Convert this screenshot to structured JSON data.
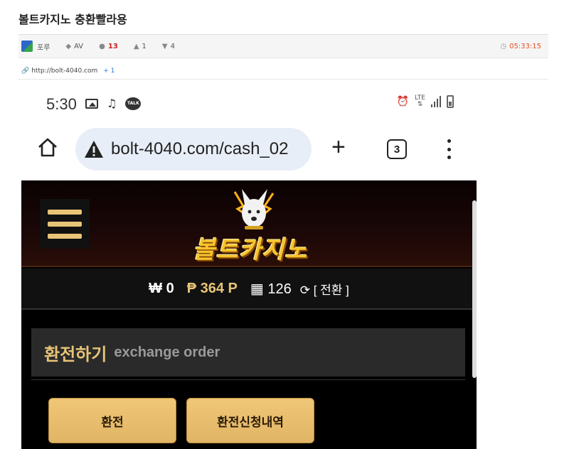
{
  "post": {
    "title": "볼트카지노 충환빨라용",
    "author": "포루",
    "category": "AV",
    "comments": "13",
    "likes": "1",
    "dislikes": "4",
    "time": "05:33:15",
    "link": "http://bolt-4040.com",
    "link_count": "+ 1"
  },
  "phone": {
    "status_time": "5:30",
    "talk_badge": "TALK",
    "lte_label": "LTE",
    "url": "bolt-4040.com/cash_02",
    "tab_count": "3"
  },
  "site": {
    "logo_text": "볼트카지노",
    "balance": {
      "won_symbol": "₩",
      "won": "0",
      "point_symbol": "₱",
      "point": "364 P",
      "ticket": "126",
      "switch_label": "[ 전환 ]"
    },
    "section_title": "환전하기",
    "section_subtitle": "exchange order",
    "buttons": {
      "exchange": "환전",
      "history": "환전신청내역"
    }
  },
  "colors": {
    "accent_gold": "#e8c477",
    "time_orange": "#e0522a",
    "comment_red": "#d21f1f"
  }
}
